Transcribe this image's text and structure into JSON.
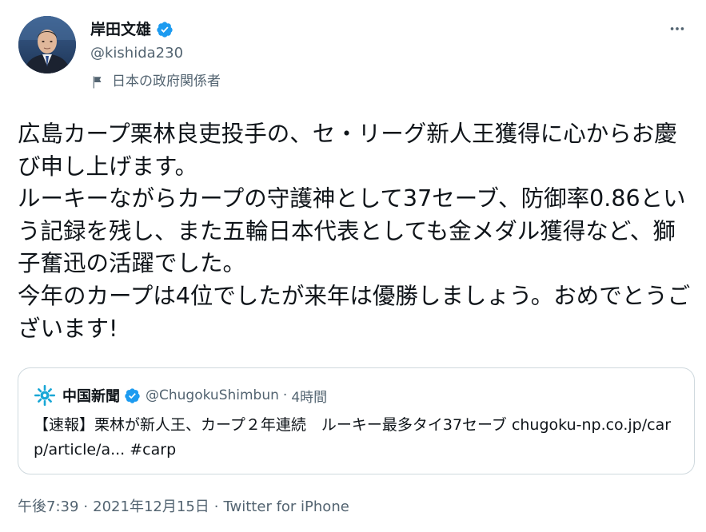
{
  "author": {
    "display_name": "岸田文雄",
    "handle": "@kishida230",
    "affiliation": "日本の政府関係者",
    "verified": true
  },
  "tweet": {
    "text": "広島カープ栗林良吏投手の、セ・リーグ新人王獲得に心からお慶び申し上げます。\nルーキーながらカープの守護神として37セーブ、防御率0.86という記録を残し、また五輪日本代表としても金メダル獲得など、獅子奮迅の活躍でした。\n今年のカープは4位でしたが来年は優勝しましょう。おめでとうございます!"
  },
  "quoted_tweet": {
    "display_name": "中国新聞",
    "handle": "@ChugokuShimbun",
    "separator": "·",
    "time": "4時間",
    "verified": true,
    "text": "【速報】栗林が新人王、カープ２年連続　ルーキー最多タイ37セーブ chugoku-np.co.jp/carp/article/a... #carp"
  },
  "meta": {
    "time": "午後7:39",
    "separator_1": "·",
    "date": "2021年12月15日",
    "separator_2": "·",
    "source": "Twitter for iPhone"
  },
  "icons": {
    "more": "more-horizontal-icon",
    "verified": "verified-badge-icon",
    "affiliation": "flag-icon"
  },
  "colors": {
    "verified_blue": "#1d9bf0",
    "secondary_text": "#536471",
    "primary_text": "#0f1419",
    "border": "#cfd9de"
  }
}
